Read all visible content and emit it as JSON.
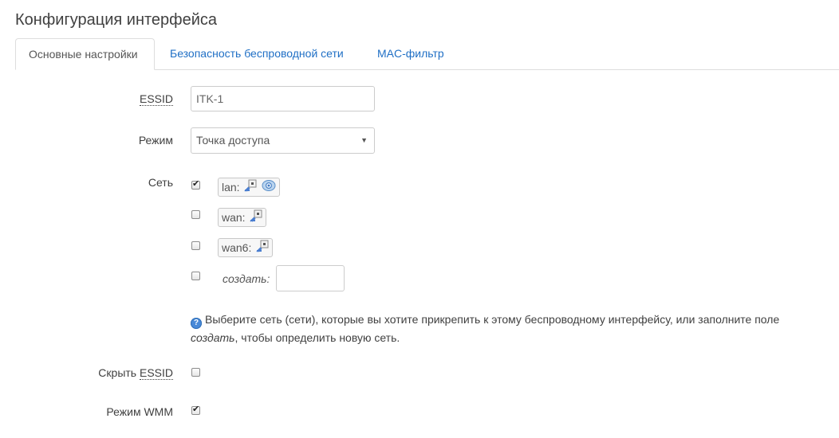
{
  "page": {
    "title": "Конфигурация интерфейса"
  },
  "tabs": [
    {
      "label": "Основные настройки",
      "active": true
    },
    {
      "label": "Безопасность беспроводной сети",
      "active": false
    },
    {
      "label": "MAC-фильтр",
      "active": false
    }
  ],
  "fields": {
    "essid": {
      "label": "ESSID",
      "value": "ITK-1"
    },
    "mode": {
      "label": "Режим",
      "selected": "Точка доступа"
    },
    "network": {
      "label": "Сеть",
      "options": [
        {
          "name": "lan:",
          "checked": true
        },
        {
          "name": "wan:",
          "checked": false
        },
        {
          "name": "wan6:",
          "checked": false
        }
      ],
      "create_label": "создать:",
      "create_value": ""
    },
    "help": {
      "text_before": "Выберите сеть (сети), которые вы хотите прикрепить к этому беспроводному интерфейсу, или заполните поле ",
      "italic": "создать",
      "text_after": ", чтобы определить новую сеть."
    },
    "hide_essid": {
      "label_prefix": "Скрыть ",
      "label_abbr": "ESSID",
      "checked": false
    },
    "wmm": {
      "label": "Режим WMM",
      "checked": true
    }
  },
  "icons": {
    "network_port": "ethernet-port-icon",
    "wireless": "wireless-icon",
    "help": "help-icon"
  }
}
